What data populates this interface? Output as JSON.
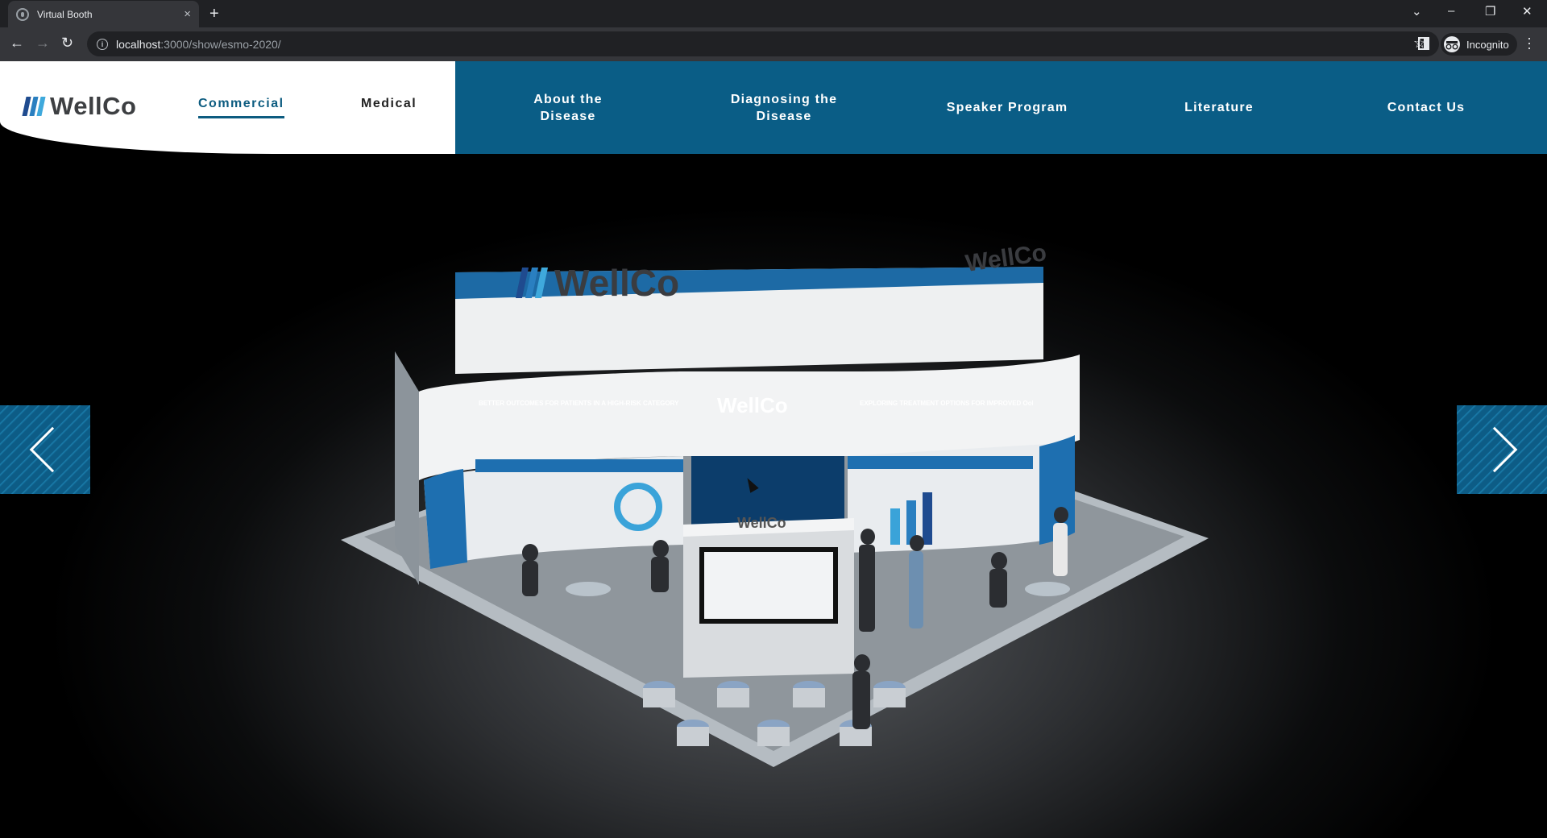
{
  "browser": {
    "tab_title": "Virtual Booth",
    "tab_close": "×",
    "new_tab": "+",
    "url_host": "localhost",
    "url_path": ":3000/show/esmo-2020/",
    "profile_label": "Incognito",
    "icons": [
      "globe-icon",
      "back-arrow-icon",
      "forward-arrow-icon",
      "reload-icon",
      "info-icon",
      "star-icon",
      "side-panel-icon",
      "incognito-icon",
      "kebab-menu-icon",
      "tab-search-icon",
      "minimize-icon",
      "restore-icon",
      "close-window-icon"
    ]
  },
  "site": {
    "brand": "WellCo",
    "brand_colors": [
      "#1f4b8f",
      "#2a7fc0",
      "#3fa9dc"
    ],
    "accent": "#0a5d86",
    "nav_left": [
      {
        "label": "Commercial",
        "active": true
      },
      {
        "label": "Medical",
        "active": false
      }
    ],
    "nav_right": [
      {
        "line1": "About the",
        "line2": "Disease"
      },
      {
        "line1": "Diagnosing the",
        "line2": "Disease"
      },
      {
        "line1": "Speaker Program",
        "line2": ""
      },
      {
        "line1": "Literature",
        "line2": ""
      },
      {
        "line1": "Contact Us",
        "line2": ""
      }
    ]
  },
  "booth": {
    "sign_main": "WellCo",
    "sign_side": "WellCo",
    "center_panel": "WellCo",
    "screen": "WellCo",
    "left_panel_heading": "BETTER OUTCOMES FOR PATIENTS IN A HIGH-RISK CATEGORY",
    "right_panel_heading": "EXPLORING TREATMENT OPTIONS FOR IMPROVED OoL and OS"
  },
  "carousel": {
    "prev_icon": "chevron-left-icon",
    "next_icon": "chevron-right-icon"
  }
}
